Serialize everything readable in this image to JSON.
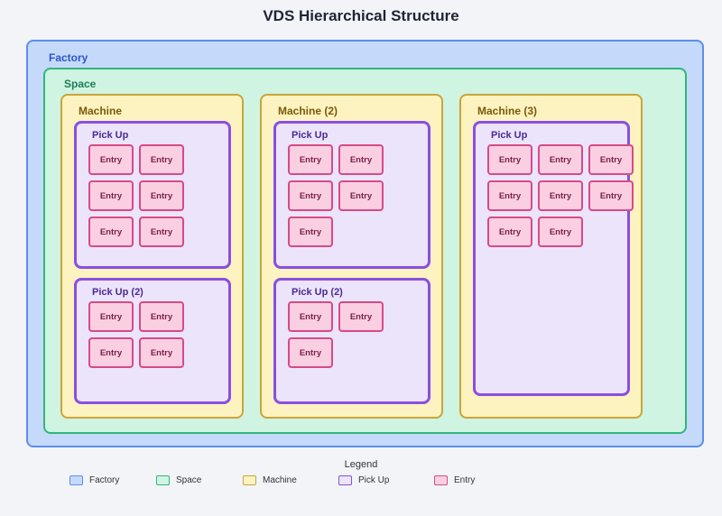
{
  "title": "VDS Hierarchical Structure",
  "factory": {
    "label": "Factory",
    "space": {
      "label": "Space",
      "machines": [
        {
          "label": "Machine",
          "pickups": [
            {
              "label": "Pick Up",
              "entries": [
                "Entry",
                "Entry",
                "Entry",
                "Entry",
                "Entry",
                "Entry"
              ]
            },
            {
              "label": "Pick Up (2)",
              "entries": [
                "Entry",
                "Entry",
                "Entry",
                "Entry"
              ]
            }
          ]
        },
        {
          "label": "Machine (2)",
          "pickups": [
            {
              "label": "Pick Up",
              "entries": [
                "Entry",
                "Entry",
                "Entry",
                "Entry",
                "Entry"
              ]
            },
            {
              "label": "Pick Up (2)",
              "entries": [
                "Entry",
                "Entry",
                "Entry"
              ]
            }
          ]
        },
        {
          "label": "Machine (3)",
          "pickups": [
            {
              "label": "Pick Up",
              "entries": [
                "Entry",
                "Entry",
                "Entry",
                "Entry",
                "Entry",
                "Entry",
                "Entry",
                "Entry"
              ]
            }
          ]
        }
      ]
    }
  },
  "legend": {
    "title": "Legend",
    "items": [
      {
        "label": "Factory",
        "fill": "#c5dafa",
        "stroke": "#5b8ef0"
      },
      {
        "label": "Space",
        "fill": "#d0f4e2",
        "stroke": "#2fb67a"
      },
      {
        "label": "Machine",
        "fill": "#fdf3c0",
        "stroke": "#c9a53a"
      },
      {
        "label": "Pick Up",
        "fill": "#ece4fb",
        "stroke": "#8a4fe0"
      },
      {
        "label": "Entry",
        "fill": "#fbcfe2",
        "stroke": "#d64b86"
      }
    ]
  }
}
